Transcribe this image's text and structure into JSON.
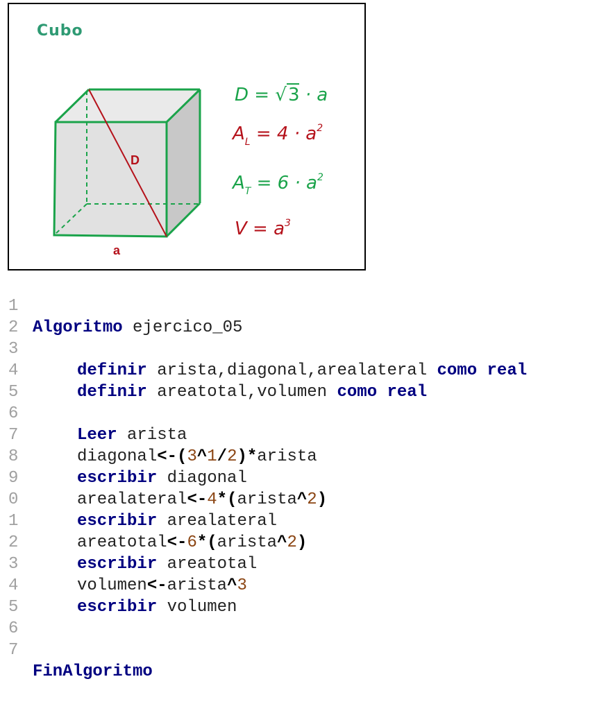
{
  "figure": {
    "title": "Cubo",
    "label_diagonal": "D",
    "label_edge": "a",
    "formulas": {
      "diagonal": {
        "lhs": "D",
        "eq": " = ",
        "root": "3",
        "rest": " · a"
      },
      "lateral": {
        "lhs": "A",
        "sub": "L",
        "eq": " = 4 · a",
        "sup": "2"
      },
      "total": {
        "lhs": "A",
        "sub": "T",
        "eq": " = 6 · a",
        "sup": "2"
      },
      "volume": {
        "lhs": "V",
        "eq": " = a",
        "sup": "3"
      }
    },
    "colors": {
      "title": "#2e9a73",
      "edges": "#1aa34a",
      "diagonal": "#b5121b",
      "faces": "#d9d9d9"
    }
  },
  "code": {
    "line_numbers": [
      "1",
      "2",
      "3",
      "4",
      "5",
      "6",
      "7",
      "8",
      "9",
      "0",
      "1",
      "2",
      "3",
      "4",
      "5",
      "6",
      "7"
    ],
    "l1": {
      "kw": "Algoritmo",
      "rest": " ejercico_05"
    },
    "l3": {
      "kw1": "definir",
      "vars": " arista,diagonal,arealateral ",
      "kw2": "como",
      "kw3": "real"
    },
    "l4": {
      "kw1": "definir",
      "vars": " areatotal,volumen ",
      "kw2": "como",
      "kw3": "real"
    },
    "l6": {
      "kw": "Leer",
      "rest": " arista"
    },
    "l7": {
      "a": "diagonal",
      "op1": "<-(",
      "n1": "3",
      "op2": "^",
      "n2": "1",
      "op3": "/",
      "n3": "2",
      "op4": ")*",
      "b": "arista"
    },
    "l8": {
      "kw": "escribir",
      "rest": " diagonal"
    },
    "l9": {
      "a": "arealateral",
      "op1": "<-",
      "n1": "4",
      "op2": "*(",
      "b": "arista",
      "op3": "^",
      "n2": "2",
      "op4": ")"
    },
    "l10": {
      "kw": "escribir",
      "rest": " arealateral"
    },
    "l11": {
      "a": "areatotal",
      "op1": "<-",
      "n1": "6",
      "op2": "*(",
      "b": "arista",
      "op3": "^",
      "n2": "2",
      "op4": ")"
    },
    "l12": {
      "kw": "escribir",
      "rest": " areatotal"
    },
    "l13": {
      "a": "volumen",
      "op1": "<-",
      "b": "arista",
      "op2": "^",
      "n1": "3"
    },
    "l14": {
      "kw": "escribir",
      "rest": " volumen"
    },
    "l17": {
      "kw": "FinAlgoritmo"
    }
  }
}
